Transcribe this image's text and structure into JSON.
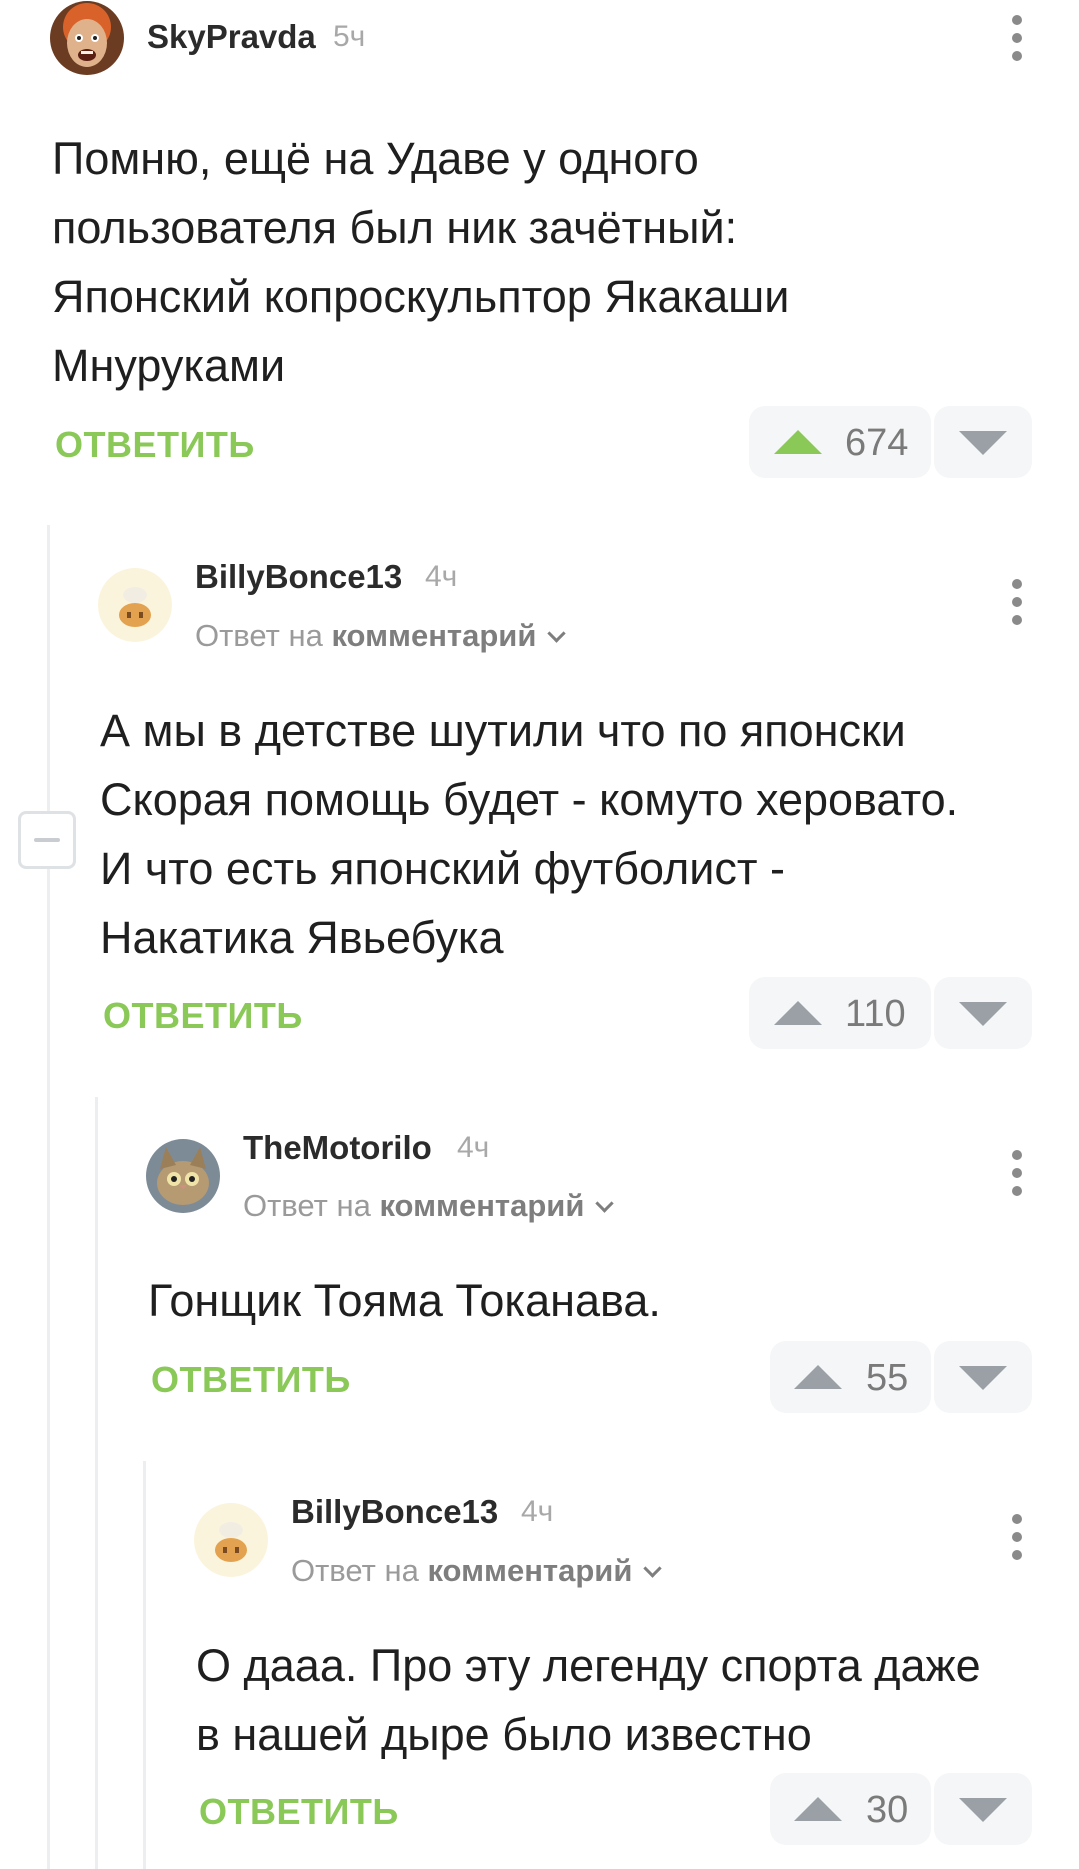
{
  "comments": [
    {
      "author": "SkyPravda",
      "time": "5ч",
      "text_lines": [
        "Помню, ещё на Удаве у одного",
        "пользователя был ник зачётный:",
        "Японский копроскульптор Якакаши",
        "Мнуруками"
      ],
      "reply_label": "ОТВЕТИТЬ",
      "score": "674",
      "avatar_icon": "photo-avatar-face"
    },
    {
      "author": "BillyBonce13",
      "time": "4ч",
      "reply_to_prefix": "Ответ на",
      "reply_to_target": "комментарий",
      "text_lines": [
        "А мы в детстве шутили что по японски",
        "Скорая помощь будет - комуто херовато.",
        "И что есть японский футболист -",
        "Накатика Явьебука"
      ],
      "reply_label": "ОТВЕТИТЬ",
      "score": "110",
      "avatar_icon": "cartoon-avatar"
    },
    {
      "author": "TheMotorilo",
      "time": "4ч",
      "reply_to_prefix": "Ответ на",
      "reply_to_target": "комментарий",
      "text_lines": [
        "Гонщик Тояма Токанава."
      ],
      "reply_label": "ОТВЕТИТЬ",
      "score": "55",
      "avatar_icon": "cat-avatar"
    },
    {
      "author": "BillyBonce13",
      "time": "4ч",
      "reply_to_prefix": "Ответ на",
      "reply_to_target": "комментарий",
      "text_lines": [
        "О дааа. Про эту легенду спорта даже",
        "в нашей дыре было известно"
      ],
      "reply_label": "ОТВЕТИТЬ",
      "score": "30",
      "avatar_icon": "cartoon-avatar"
    }
  ],
  "colors": {
    "accent_green": "#8ac858",
    "vote_bg": "#f5f6f7",
    "meta_gray": "#a8a8a8"
  }
}
